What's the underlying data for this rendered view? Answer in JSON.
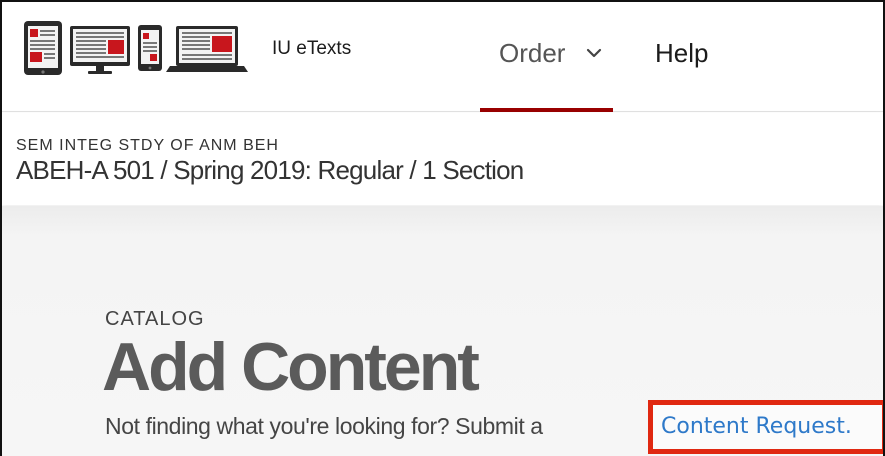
{
  "header": {
    "logo_icons": [
      "tablet-icon",
      "desktop-monitor-icon",
      "smartphone-icon",
      "laptop-icon"
    ],
    "brand_name": "IU eTexts",
    "nav": {
      "order_label": "Order",
      "order_chevron_icon": "chevron-down-icon",
      "help_label": "Help"
    },
    "active_nav_color": "#990000"
  },
  "course": {
    "code_line": "SEM INTEG STDY OF ANM BEH",
    "title_line": "ABEH-A 501 / Spring 2019: Regular / 1 Section"
  },
  "catalog": {
    "eyebrow": "CATALOG",
    "heading": "Add Content",
    "prompt_text": "Not finding what you're looking for? Submit a",
    "request_link_text": "Content Request.",
    "link_color": "#2e79c9",
    "highlight_color": "#e02811"
  }
}
